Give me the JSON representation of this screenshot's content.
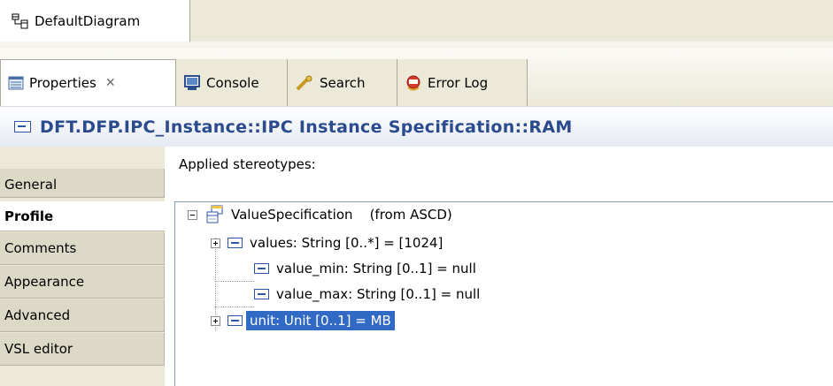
{
  "editor_tab": {
    "label": "DefaultDiagram",
    "icon": "diagram-icon"
  },
  "view_tabs": [
    {
      "label": "Properties",
      "icon": "properties-icon",
      "closable": true,
      "active": true
    },
    {
      "label": "Console",
      "icon": "console-icon"
    },
    {
      "label": "Search",
      "icon": "search-icon"
    },
    {
      "label": "Error Log",
      "icon": "error-log-icon"
    }
  ],
  "title": {
    "icon": "property-icon",
    "text": "DFT.DFP.IPC_Instance::IPC Instance Specification::RAM"
  },
  "section_tabs": [
    {
      "label": "General"
    },
    {
      "label": "Profile",
      "active": true
    },
    {
      "label": "Comments"
    },
    {
      "label": "Appearance"
    },
    {
      "label": "Advanced"
    },
    {
      "label": "VSL editor"
    }
  ],
  "content": {
    "applied_label": "Applied stereotypes:",
    "tree": {
      "root": {
        "label": "ValueSpecification    (from ASCD)",
        "expanded": true
      },
      "children": [
        {
          "label": "values: String [0..*] = [1024]",
          "expandable": true
        },
        {
          "label": "value_min: String [0..1] = null",
          "expandable": false
        },
        {
          "label": "value_max: String [0..1] = null",
          "expandable": false
        },
        {
          "label": "unit: Unit [0..1] = MB",
          "expandable": true,
          "selected": true
        }
      ]
    }
  },
  "colors": {
    "selection": "#316ac5",
    "title_text": "#2a4b8d",
    "tab_bg": "#ece9d8"
  }
}
